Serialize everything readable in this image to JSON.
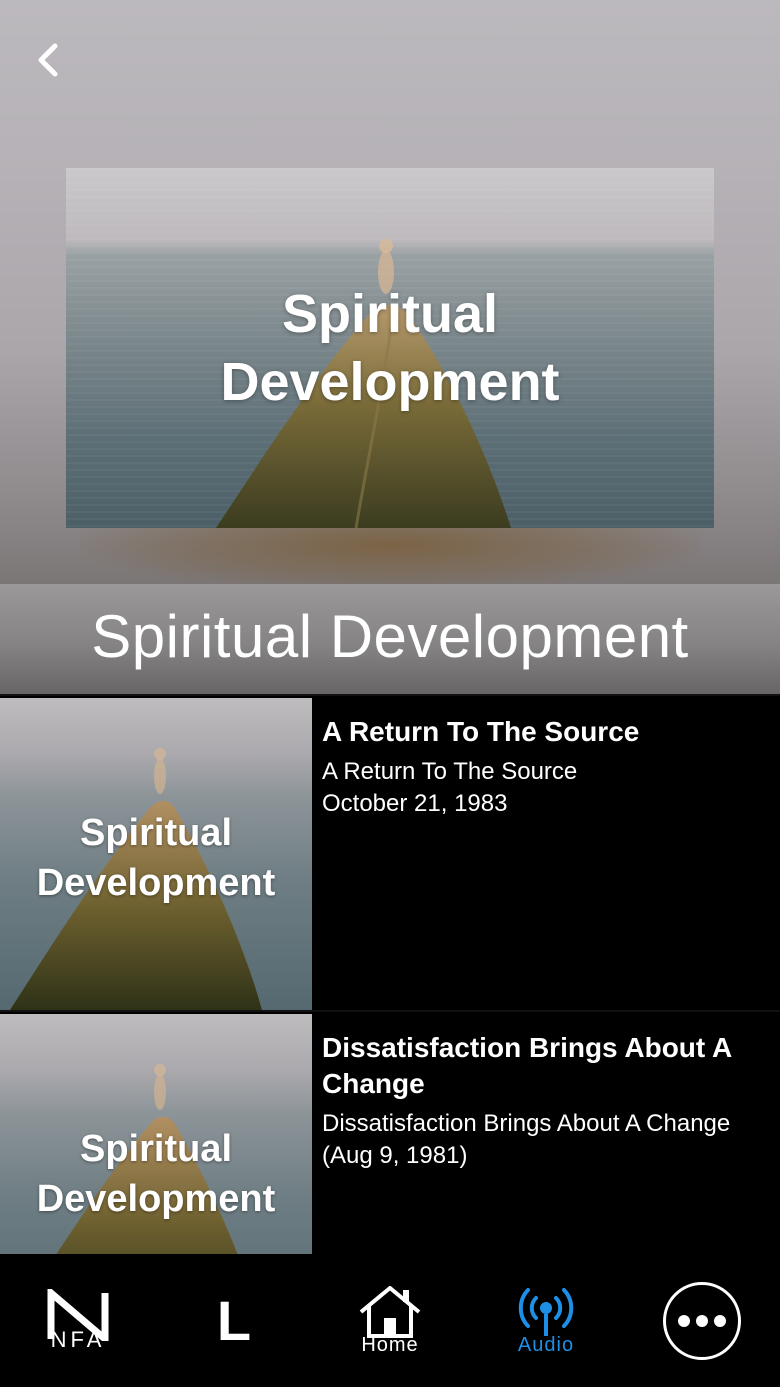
{
  "header": {
    "back_icon": "chevron-left-icon",
    "cover_title_line1": "Spiritual",
    "cover_title_line2": "Development"
  },
  "section": {
    "title": "Spiritual Development"
  },
  "items": [
    {
      "thumb_line1": "Spiritual",
      "thumb_line2": "Development",
      "title": "A Return To The Source",
      "subtitle": "A Return To The Source\nOctober 21, 1983"
    },
    {
      "thumb_line1": "Spiritual",
      "thumb_line2": "Development",
      "title": "Dissatisfaction Brings About A Change",
      "subtitle": "Dissatisfaction Brings About A Change\n(Aug 9, 1981)"
    }
  ],
  "tabbar": {
    "tabs": [
      {
        "id": "nfa",
        "label": "NFA",
        "icon": "n-logo-icon"
      },
      {
        "id": "l",
        "label": "L",
        "icon": "l-logo-icon"
      },
      {
        "id": "home",
        "label": "Home",
        "icon": "home-icon"
      },
      {
        "id": "audio",
        "label": "Audio",
        "icon": "broadcast-icon",
        "active": true
      },
      {
        "id": "more",
        "label": "",
        "icon": "more-dots-icon"
      }
    ],
    "active_color": "#1e8fe6"
  }
}
